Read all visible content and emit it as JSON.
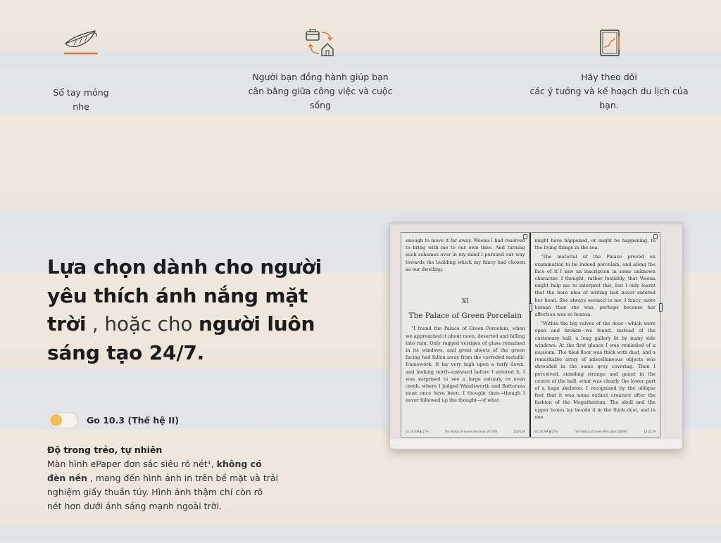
{
  "features": [
    {
      "icon": "feather-icon",
      "text_line1": "Sổ tay mỏng",
      "text_line2": "nhẹ"
    },
    {
      "icon": "work-home-balance-icon",
      "text_line1": "Người bạn đồng hành giúp bạn",
      "text_line2": "cân bằng giữa công việc và cuộc",
      "text_line3": "sống"
    },
    {
      "icon": "notebook-sketch-icon",
      "text_line1": "Hãy theo dõi",
      "text_line2": "các ý tưởng và kế hoạch du lịch của",
      "text_line3": "bạn."
    }
  ],
  "headline": {
    "part1": "Lựa chọn dành cho người yêu thích ánh nắng mặt trời",
    "part2": " , hoặc cho ",
    "part3": "người luôn sáng tạo 24/7."
  },
  "toggle": {
    "label": "Go 10.3 (Thế hệ II)",
    "state": "off",
    "knob_color": "#eec05a"
  },
  "description": {
    "title": "Độ trong trẻo, tự nhiên",
    "text1": "Màn hình ePaper đơn sắc siêu rõ nét¹, ",
    "bold": "không có đèn nền",
    "text2": " , mang đến hình ảnh in trên bề mặt và trải nghiệm giấy thuần túy. Hình ảnh thậm chí còn rõ nét hơn dưới ánh sáng mạnh ngoài trời."
  },
  "ereader": {
    "left_page": {
      "para1": "enough to move it far away. Weena I had resolved to bring with me to our own time. And turning such schemes over in my mind I pursued our way towards the building which my fancy had chosen as our dwelling.",
      "chapter_number": "XI",
      "chapter_title": "The Palace of Green Porcelain",
      "para2": "“I found the Palace of Green Porcelain, when we approached it about noon, deserted and falling into ruin. Only ragged vestiges of glass remained in its windows, and great sheets of the green facing had fallen away from the corroded metallic framework. It lay very high upon a turfy down, and looking north-eastward before I entered it, I was surprised to see a large estuary, or even creek, where I judged Wandsworth and Battersea must once have been. I thought then—though I never followed up the thought—of what",
      "footer_left": "01:16 AM   ▮ 57%",
      "footer_mid": "The Palace of Green Porcelain (97/49)",
      "footer_right": "120/134"
    },
    "right_page": {
      "para1": "might have happened, or might be happening, to the living things in the sea.",
      "para2": "“The material of the Palace proved on examination to be indeed porcelain, and along the face of it I saw an inscription in some unknown character. I thought, rather foolishly, that Weena might help me to interpret this, but I only learnt that the bare idea of writing had never entered her head. She always seemed to me, I fancy, more human than she was, perhaps because her affection was so human.",
      "para3": "“Within the big valves of the door—which were open and broken—we found, instead of the customary hall, a long gallery lit by many side windows. At the first glance I was reminded of a museum. The tiled floor was thick with dust, and a remarkable array of miscellaneous objects was shrouded in the same grey covering. Then I perceived, standing strange and gaunt in the centre of the hall, what was clearly the lower part of a huge skeleton. I recognised by the oblique feet that it was some extinct creature after the fashion of the Megatherium. The skull and the upper bones lay beside it in the thick dust, and in one",
      "footer_left": "01:16 AM   ▮ 57%",
      "footer_mid": "The Palace of Green Porcelain (58/49)",
      "footer_right": "121/134"
    }
  }
}
